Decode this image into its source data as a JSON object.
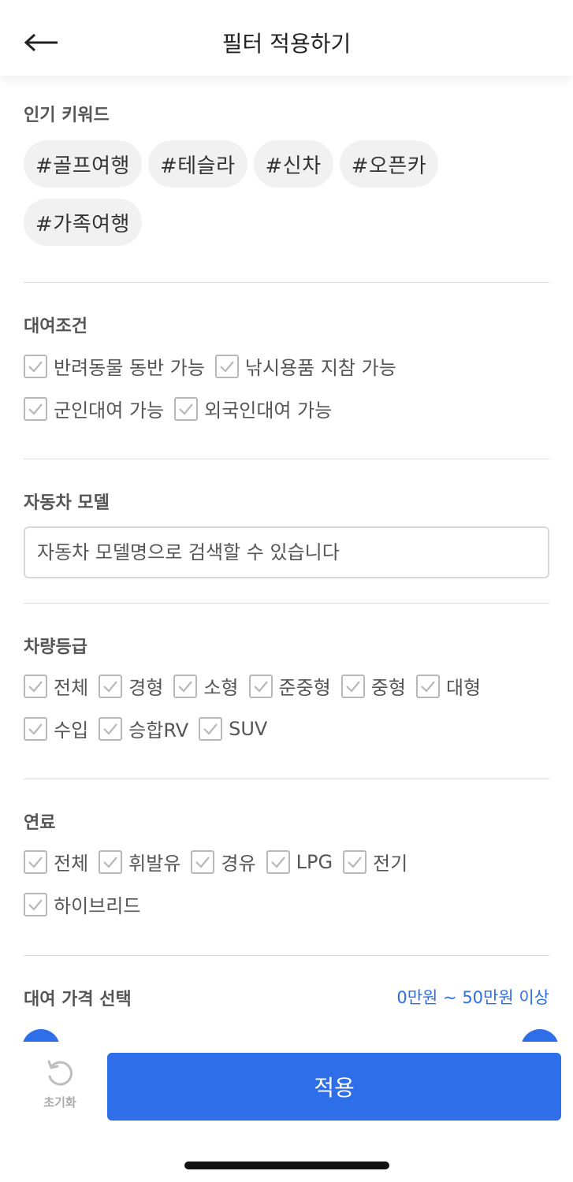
{
  "header": {
    "title": "필터 적용하기"
  },
  "keywords": {
    "title": "인기 키워드",
    "chips": [
      "#골프여행",
      "#테슬라",
      "#신차",
      "#오픈카",
      "#가족여행"
    ]
  },
  "rental_conditions": {
    "title": "대여조건",
    "options": [
      "반려동물 동반 가능",
      "낚시용품 지참 가능",
      "군인대여 가능",
      "외국인대여 가능"
    ]
  },
  "car_model": {
    "title": "자동차 모델",
    "placeholder": "자동차 모델명으로 검색할 수 있습니다"
  },
  "car_grade": {
    "title": "차량등급",
    "options": [
      "전체",
      "경형",
      "소형",
      "준중형",
      "중형",
      "대형",
      "수입",
      "승합RV",
      "SUV"
    ]
  },
  "fuel": {
    "title": "연료",
    "options": [
      "전체",
      "휘발유",
      "경유",
      "LPG",
      "전기",
      "하이브리드"
    ]
  },
  "price": {
    "title": "대여 가격 선택",
    "range_text": "0만원 ~ 50만원 이상"
  },
  "bottom": {
    "reset_label": "초기화",
    "apply_label": "적용"
  },
  "colors": {
    "accent": "#2f6ee9",
    "chip_bg": "#f1f1f1",
    "divider": "#dedede"
  }
}
